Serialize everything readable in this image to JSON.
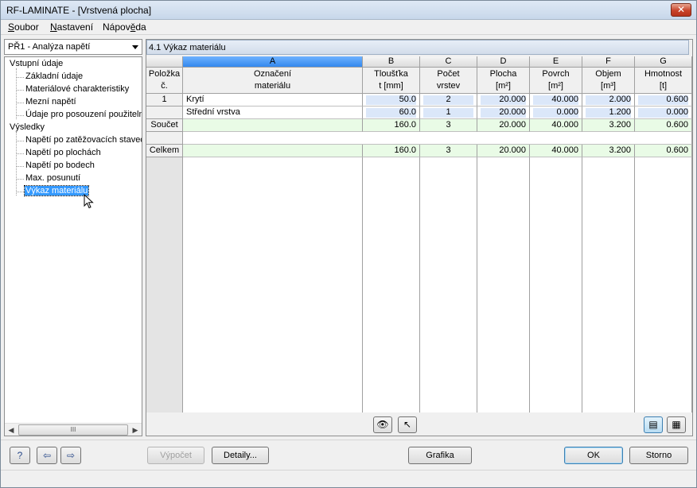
{
  "window": {
    "title": "RF-LAMINATE - [Vrstvená plocha]",
    "close_glyph": "✕"
  },
  "menu": {
    "items": [
      {
        "hot": "S",
        "rest": "oubor"
      },
      {
        "hot": "N",
        "rest": "astavení"
      },
      {
        "pre": "Nápov",
        "hot": "ě",
        "rest": "da"
      }
    ]
  },
  "case_select": {
    "value": "PŘ1 - Analýza napětí"
  },
  "tree": {
    "input_root": "Vstupní údaje",
    "input_items": [
      "Základní údaje",
      "Materiálové charakteristiky",
      "Mezní napětí",
      "Údaje pro posouzení použitelnc"
    ],
    "results_root": "Výsledky",
    "results_items": [
      "Napětí po zatěžovacích stavec",
      "Napětí po plochách",
      "Napětí po bodech",
      "Max. posunutí",
      "Výkaz materiálu"
    ]
  },
  "scrollbar": {
    "thumb_glyph": "III",
    "left_glyph": "◀",
    "right_glyph": "▶"
  },
  "section": {
    "title": "4.1 Výkaz materiálu"
  },
  "table": {
    "col_letters": [
      "A",
      "B",
      "C",
      "D",
      "E",
      "F",
      "G"
    ],
    "rowhdr_header": {
      "line1": "Položka",
      "line2": "č."
    },
    "headers": [
      {
        "line1": "Označení",
        "line2": "materiálu"
      },
      {
        "line1": "Tloušťka",
        "line2": "t [mm]"
      },
      {
        "line1": "Počet",
        "line2": "vrstev"
      },
      {
        "line1": "Plocha",
        "line2": "[m²]"
      },
      {
        "line1": "Povrch",
        "line2": "[m²]"
      },
      {
        "line1": "Objem",
        "line2": "[m³]"
      },
      {
        "line1": "Hmotnost",
        "line2": "[t]"
      }
    ],
    "rows": [
      {
        "label": "1",
        "cells": [
          "Krytí",
          "50.0",
          "2",
          "20.000",
          "40.000",
          "2.000",
          "0.600"
        ]
      },
      {
        "label": "",
        "cells": [
          "Střední vrstva",
          "60.0",
          "1",
          "20.000",
          "0.000",
          "1.200",
          "0.000"
        ]
      },
      {
        "label": "Součet",
        "cells": [
          "",
          "160.0",
          "3",
          "20.000",
          "40.000",
          "3.200",
          "0.600"
        ]
      },
      {
        "label": "",
        "cells": [
          "",
          "",
          "",
          "",
          "",
          "",
          ""
        ]
      },
      {
        "label": "Celkem",
        "cells": [
          "",
          "160.0",
          "3",
          "20.000",
          "40.000",
          "3.200",
          "0.600"
        ]
      }
    ]
  },
  "toolbar_icons": {
    "eye": "👁",
    "pick": "↖",
    "filter": "▤",
    "export": "▦"
  },
  "buttons": {
    "help_glyph": "?",
    "prev_glyph": "⇦",
    "next_glyph": "⇨",
    "calc": "Výpočet",
    "details": "Detaily...",
    "graphics": "Grafika",
    "ok": "OK",
    "cancel": "Storno"
  }
}
